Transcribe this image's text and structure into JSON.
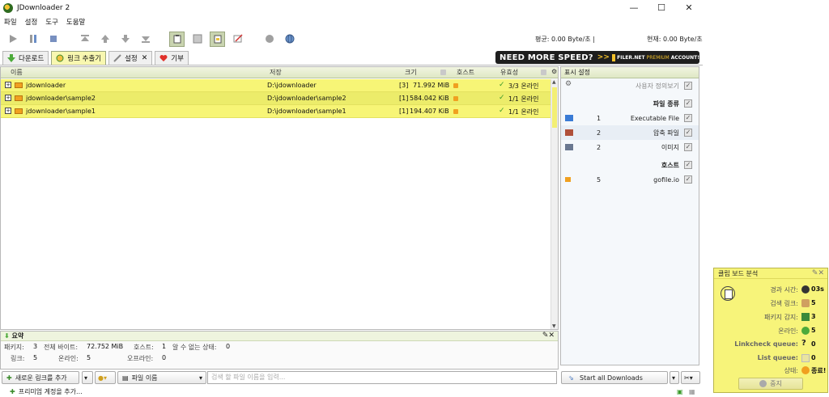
{
  "window": {
    "title": "JDownloader 2",
    "minimize": "—",
    "maximize": "☐",
    "close": "✕"
  },
  "menu": [
    "파일",
    "설정",
    "도구",
    "도움말"
  ],
  "toolbar": {
    "speed_average": "평균: 0.00 Byte/초 |",
    "speed_current": "현재: 0.00 Byte/초"
  },
  "tabs": [
    {
      "label": "다운로드",
      "icon": "download-arrow-icon"
    },
    {
      "label": "링크 추출기",
      "icon": "link-grabber-icon",
      "active": true
    },
    {
      "label": "설정",
      "icon": "settings-icon"
    },
    {
      "label": "기부",
      "icon": "heart-icon"
    }
  ],
  "banner": {
    "main": "NEED MORE SPEED?",
    "arrows": ">>",
    "brand": "FILER.NET",
    "premium": "PREMIUM",
    "account": "ACCOUNT!"
  },
  "table": {
    "columns": {
      "name": "이름",
      "save": "저장",
      "size": "크기",
      "host": "호스트",
      "availability": "유효성"
    },
    "rows": [
      {
        "name": "jdownloader",
        "path": "D:\\jdownloader",
        "count": "[3]",
        "size": "71.992 MiB",
        "status": "3/3 온라인"
      },
      {
        "name": "jdownloader\\sample2",
        "path": "D:\\jdownloader\\sample2",
        "count": "[1]",
        "size": "584.042 KiB",
        "status": "1/1 온라인"
      },
      {
        "name": "jdownloader\\sample1",
        "path": "D:\\jdownloader\\sample1",
        "count": "[1]",
        "size": "194.407 KiB",
        "status": "1/1 온라인"
      }
    ]
  },
  "side": {
    "header": "표시 설정",
    "custom_view": "사용자 정의보기",
    "file_types_header": "파일 종류",
    "file_types": [
      {
        "count": "1",
        "label": "Executable File"
      },
      {
        "count": "2",
        "label": "압축 파일"
      },
      {
        "count": "2",
        "label": "이미지"
      }
    ],
    "hosts_header": "호스트",
    "hosts": [
      {
        "count": "5",
        "label": "gofile.io"
      }
    ]
  },
  "summary": {
    "title": "요약",
    "tools": "✎✕",
    "packages_label": "패키지:",
    "packages": "3",
    "total_bytes_label": "전체 바이트:",
    "total_bytes": "72.752 MiB",
    "hosts_label": "호스트:",
    "hosts": "1",
    "unknown_label": "알 수 없는 상태:",
    "unknown": "0",
    "links_label": "링크:",
    "links": "5",
    "online_label": "온라인:",
    "online": "5",
    "offline_label": "오프라인:",
    "offline": "0"
  },
  "bottom": {
    "add_links": "새로운 링크를 추가",
    "filter": "파일 이름",
    "search_placeholder": "검색 할 파일 이름을 입력...",
    "start_all": "Start all Downloads"
  },
  "status": {
    "add_premium": "프리미엄 계정을 추가..."
  },
  "clipboard": {
    "title": "클립 보드 분석",
    "elapsed_label": "경과 시간:",
    "elapsed": "03s",
    "found_links_label": "검색 링크:",
    "found_links": "5",
    "packages_label": "패키지 감지:",
    "packages": "3",
    "online_label": "온라인:",
    "online": "5",
    "linkcheck_label": "Linkcheck queue:",
    "linkcheck": "0",
    "list_label": "List queue:",
    "list": "0",
    "state_label": "상태:",
    "state": "종료!",
    "stop": "중지"
  }
}
